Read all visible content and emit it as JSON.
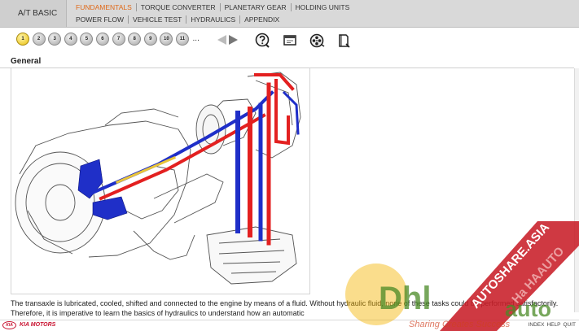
{
  "header": {
    "title": "A/T BASIC",
    "nav_row1": [
      "FUNDAMENTALS",
      "TORQUE CONVERTER",
      "PLANETARY GEAR",
      "HOLDING UNITS"
    ],
    "nav_row2": [
      "POWER FLOW",
      "VEHICLE TEST",
      "HYDRAULICS",
      "APPENDIX"
    ],
    "active_nav": "FUNDAMENTALS",
    "accent_color": "#e06a1a"
  },
  "toolbar": {
    "pages": [
      "1",
      "2",
      "3",
      "4",
      "5",
      "6",
      "7",
      "8",
      "9",
      "10",
      "11"
    ],
    "current_page": "1",
    "ellipsis": "...",
    "icons": [
      "prev-arrow-icon",
      "next-arrow-icon",
      "help-icon",
      "window-icon",
      "film-reel-icon",
      "book-icon"
    ]
  },
  "content": {
    "section_title": "General",
    "description": "The transaxle is lubricated, cooled, shifted and connected to the engine by means of a fluid. Without hydraulic fluid, none of these tasks could be performed satisfactorily. Therefore, it is imperative to learn the basics of hydraulics to understand how an automatic"
  },
  "footer": {
    "logo_mark": "KIA",
    "logo_text": "KIA MOTORS",
    "links": [
      "INDEX",
      "HELP",
      "QUIT"
    ]
  },
  "watermark": {
    "brand_main": "Dhl",
    "brand_suffix": "auto",
    "tagline": "Sharing Creates Success",
    "ribbon": "AUTOSHARE.ASIA",
    "ribbon_sub": "Ha HAAUTO"
  }
}
